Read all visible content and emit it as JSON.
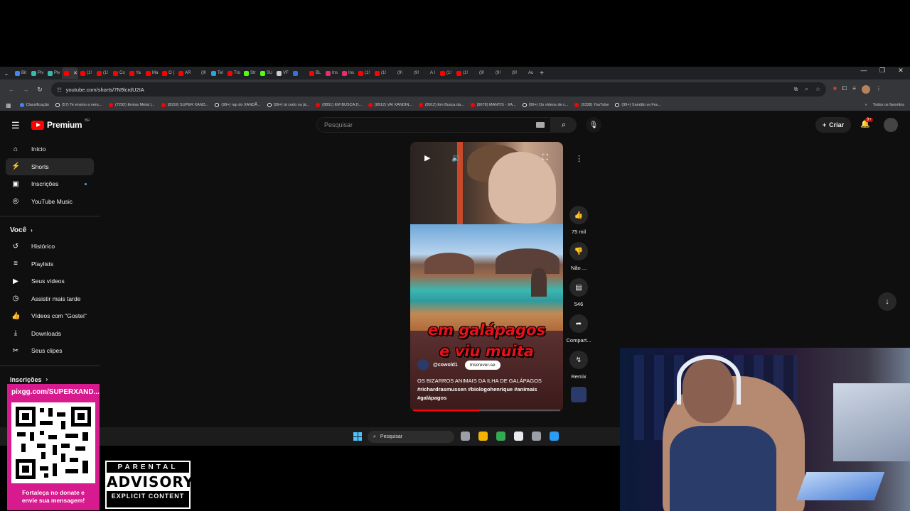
{
  "browser": {
    "tabs": [
      {
        "label": "Bit",
        "color": "#4285f4"
      },
      {
        "label": "Piv",
        "color": "#32bcad"
      },
      {
        "label": "Piv",
        "color": "#32bcad"
      },
      {
        "label": "",
        "color": "#ff0000",
        "active": true
      },
      {
        "label": "(1!",
        "color": "#ff0000"
      },
      {
        "label": "(1!",
        "color": "#ff0000"
      },
      {
        "label": "Co",
        "color": "#ff0000"
      },
      {
        "label": "Ya",
        "color": "#ff0000"
      },
      {
        "label": "Ma",
        "color": "#ff0000"
      },
      {
        "label": "O (",
        "color": "#ff0000"
      },
      {
        "label": "AR",
        "color": "#ff0000"
      },
      {
        "label": "(9!",
        "color": "#222222"
      },
      {
        "label": "Tel",
        "color": "#2aa3e0"
      },
      {
        "label": "Tro",
        "color": "#ff0000"
      },
      {
        "label": "Str",
        "color": "#53fc18"
      },
      {
        "label": "SU",
        "color": "#53fc18"
      },
      {
        "label": "VF",
        "color": "#cccccc"
      },
      {
        "label": "",
        "color": "#3a6ee8"
      },
      {
        "label": "BL",
        "color": "#ff0000"
      },
      {
        "label": "Ins",
        "color": "#e1306c"
      },
      {
        "label": "Ins",
        "color": "#e1306c"
      },
      {
        "label": "(1!",
        "color": "#ff0000"
      },
      {
        "label": "(1!",
        "color": "#ff0000"
      },
      {
        "label": "(9!",
        "color": "#222222"
      },
      {
        "label": "(9!",
        "color": "#222222"
      },
      {
        "label": "A I",
        "color": "#222222"
      },
      {
        "label": "(1!",
        "color": "#ff0000"
      },
      {
        "label": "(1!",
        "color": "#ff0000"
      },
      {
        "label": "(9!",
        "color": "#222222"
      },
      {
        "label": "(9!",
        "color": "#222222"
      },
      {
        "label": "(9!",
        "color": "#222222"
      },
      {
        "label": "Au",
        "color": "#222222"
      }
    ],
    "url": "youtube.com/shorts/7N9lcrdU2IA",
    "bookmarks": [
      {
        "label": "Classificação",
        "kind": "bl"
      },
      {
        "label": "(57) Te ensino a venc...",
        "kind": "tt"
      },
      {
        "label": "(7292) Enéas Metal |...",
        "kind": "yt"
      },
      {
        "label": "(8159) SUPER XAND...",
        "kind": "yt"
      },
      {
        "label": "(99+) rap do XANDÃ...",
        "kind": "tt"
      },
      {
        "label": "(99+) tá cedo ou já...",
        "kind": "tt"
      },
      {
        "label": "(8851) EM BUSCA D...",
        "kind": "yt"
      },
      {
        "label": "(8912) VAI XANDIN...",
        "kind": "yt"
      },
      {
        "label": "(8912) Em Busca da...",
        "kind": "yt"
      },
      {
        "label": "(9078) MANTIS - XA...",
        "kind": "yt"
      },
      {
        "label": "(99+) Os vídeos de c...",
        "kind": "tt"
      },
      {
        "label": "(9338) YouTube",
        "kind": "yt"
      },
      {
        "label": "(99+) Xandão vs Fra...",
        "kind": "tt"
      }
    ],
    "all_favorites": "Todos os favoritos"
  },
  "youtube": {
    "logo": "Premium",
    "country": "BR",
    "search_placeholder": "Pesquisar",
    "create_label": "Criar",
    "notif_count": "9+",
    "sidebar": {
      "main": [
        {
          "label": "Início",
          "icon": "home-icon",
          "glyph": "⌂"
        },
        {
          "label": "Shorts",
          "icon": "shorts-icon",
          "glyph": "⚡",
          "active": true
        },
        {
          "label": "Inscrições",
          "icon": "subscriptions-icon",
          "glyph": "▣",
          "dot": true
        },
        {
          "label": "YouTube Music",
          "icon": "music-icon",
          "glyph": "◎"
        }
      ],
      "you_label": "Você",
      "you": [
        {
          "label": "Histórico",
          "icon": "history-icon",
          "glyph": "↺"
        },
        {
          "label": "Playlists",
          "icon": "playlists-icon",
          "glyph": "≡"
        },
        {
          "label": "Seus vídeos",
          "icon": "your-videos-icon",
          "glyph": "▶"
        },
        {
          "label": "Assistir mais tarde",
          "icon": "watch-later-icon",
          "glyph": "◷"
        },
        {
          "label": "Vídeos com \"Gostei\"",
          "icon": "liked-icon",
          "glyph": "👍"
        },
        {
          "label": "Downloads",
          "icon": "download-icon",
          "glyph": "⤓"
        },
        {
          "label": "Seus clipes",
          "icon": "clips-icon",
          "glyph": "✂"
        }
      ],
      "subs_label": "Inscrições"
    },
    "short": {
      "overlay_text_1": "em galápagos",
      "overlay_text_2": "e viu muita",
      "channel": "@cowold1",
      "subscribe": "Inscrever-se",
      "title": "OS BIZARROS ANIMAIS DA ILHA DE GALÁPAGOS",
      "tags": "#richardrasmussen #biologohenrique #animais #galápagos",
      "progress": 0.45
    },
    "actions": {
      "likes": "75 mil",
      "dislike": "Não ...",
      "comments": "546",
      "share": "Compart...",
      "remix": "Remix"
    }
  },
  "taskbar": {
    "search": "Pesquisar",
    "apps": [
      "#9aa0a6",
      "#f4b400",
      "#34a853",
      "#e8eaed",
      "#9aa0a6",
      "#2a9df4"
    ]
  },
  "overlays": {
    "pix_url": "pixgg.com/SUPERXAND...",
    "donate_line1": "Fortaleça no donate e",
    "donate_line2": "envie sua mensagem!",
    "pa_top": "PARENTAL",
    "pa_mid": "ADVISORY",
    "pa_bottom": "EXPLICIT CONTENT"
  }
}
